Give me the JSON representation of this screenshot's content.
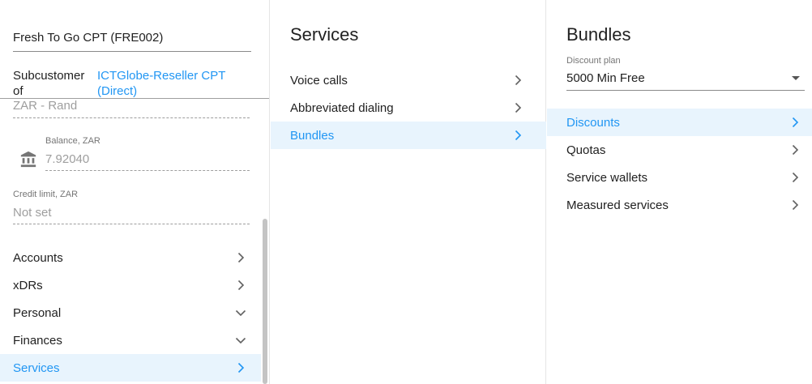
{
  "customer": {
    "name": "Fresh To Go CPT (FRE002)",
    "subcustomer_label": "Subcustomer of",
    "subcustomer_value": "ICTGlobe-Reseller CPT (Direct)",
    "currency": "ZAR - Rand",
    "balance_label": "Balance, ZAR",
    "balance_value": "7.92040",
    "credit_label": "Credit limit, ZAR",
    "credit_value": "Not set"
  },
  "nav": {
    "items": [
      {
        "label": "Accounts",
        "icon": "chevron-right-icon"
      },
      {
        "label": "xDRs",
        "icon": "chevron-right-icon"
      },
      {
        "label": "Personal",
        "icon": "chevron-down-icon"
      },
      {
        "label": "Finances",
        "icon": "chevron-down-icon"
      },
      {
        "label": "Services",
        "icon": "chevron-right-icon",
        "active": true
      }
    ]
  },
  "services": {
    "title": "Services",
    "items": [
      {
        "label": "Voice calls"
      },
      {
        "label": "Abbreviated dialing"
      },
      {
        "label": "Bundles",
        "active": true
      }
    ]
  },
  "bundles": {
    "title": "Bundles",
    "discount_plan_label": "Discount plan",
    "discount_plan_value": "5000 Min Free",
    "items": [
      {
        "label": "Discounts",
        "active": true
      },
      {
        "label": "Quotas"
      },
      {
        "label": "Service wallets"
      },
      {
        "label": "Measured services"
      }
    ]
  },
  "colors": {
    "accent": "#2196f3",
    "active_bg": "#e8f4fd"
  }
}
